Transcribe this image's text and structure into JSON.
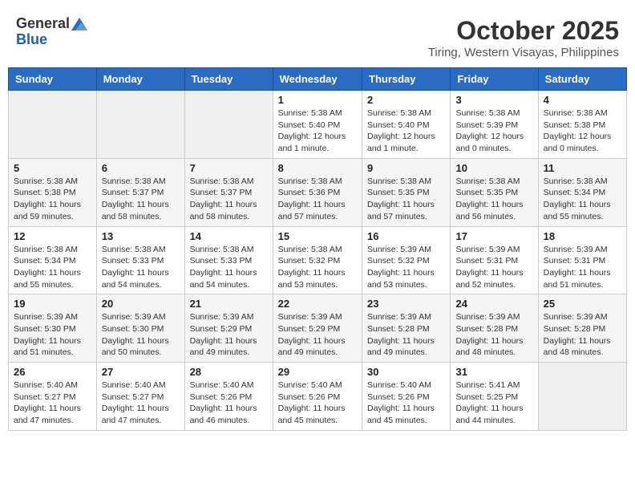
{
  "header": {
    "logo_general": "General",
    "logo_blue": "Blue",
    "month_title": "October 2025",
    "location": "Tiring, Western Visayas, Philippines"
  },
  "weekdays": [
    "Sunday",
    "Monday",
    "Tuesday",
    "Wednesday",
    "Thursday",
    "Friday",
    "Saturday"
  ],
  "weeks": [
    [
      {
        "day": "",
        "info": ""
      },
      {
        "day": "",
        "info": ""
      },
      {
        "day": "",
        "info": ""
      },
      {
        "day": "1",
        "info": "Sunrise: 5:38 AM\nSunset: 5:40 PM\nDaylight: 12 hours\nand 1 minute."
      },
      {
        "day": "2",
        "info": "Sunrise: 5:38 AM\nSunset: 5:40 PM\nDaylight: 12 hours\nand 1 minute."
      },
      {
        "day": "3",
        "info": "Sunrise: 5:38 AM\nSunset: 5:39 PM\nDaylight: 12 hours\nand 0 minutes."
      },
      {
        "day": "4",
        "info": "Sunrise: 5:38 AM\nSunset: 5:38 PM\nDaylight: 12 hours\nand 0 minutes."
      }
    ],
    [
      {
        "day": "5",
        "info": "Sunrise: 5:38 AM\nSunset: 5:38 PM\nDaylight: 11 hours\nand 59 minutes."
      },
      {
        "day": "6",
        "info": "Sunrise: 5:38 AM\nSunset: 5:37 PM\nDaylight: 11 hours\nand 58 minutes."
      },
      {
        "day": "7",
        "info": "Sunrise: 5:38 AM\nSunset: 5:37 PM\nDaylight: 11 hours\nand 58 minutes."
      },
      {
        "day": "8",
        "info": "Sunrise: 5:38 AM\nSunset: 5:36 PM\nDaylight: 11 hours\nand 57 minutes."
      },
      {
        "day": "9",
        "info": "Sunrise: 5:38 AM\nSunset: 5:35 PM\nDaylight: 11 hours\nand 57 minutes."
      },
      {
        "day": "10",
        "info": "Sunrise: 5:38 AM\nSunset: 5:35 PM\nDaylight: 11 hours\nand 56 minutes."
      },
      {
        "day": "11",
        "info": "Sunrise: 5:38 AM\nSunset: 5:34 PM\nDaylight: 11 hours\nand 55 minutes."
      }
    ],
    [
      {
        "day": "12",
        "info": "Sunrise: 5:38 AM\nSunset: 5:34 PM\nDaylight: 11 hours\nand 55 minutes."
      },
      {
        "day": "13",
        "info": "Sunrise: 5:38 AM\nSunset: 5:33 PM\nDaylight: 11 hours\nand 54 minutes."
      },
      {
        "day": "14",
        "info": "Sunrise: 5:38 AM\nSunset: 5:33 PM\nDaylight: 11 hours\nand 54 minutes."
      },
      {
        "day": "15",
        "info": "Sunrise: 5:38 AM\nSunset: 5:32 PM\nDaylight: 11 hours\nand 53 minutes."
      },
      {
        "day": "16",
        "info": "Sunrise: 5:39 AM\nSunset: 5:32 PM\nDaylight: 11 hours\nand 53 minutes."
      },
      {
        "day": "17",
        "info": "Sunrise: 5:39 AM\nSunset: 5:31 PM\nDaylight: 11 hours\nand 52 minutes."
      },
      {
        "day": "18",
        "info": "Sunrise: 5:39 AM\nSunset: 5:31 PM\nDaylight: 11 hours\nand 51 minutes."
      }
    ],
    [
      {
        "day": "19",
        "info": "Sunrise: 5:39 AM\nSunset: 5:30 PM\nDaylight: 11 hours\nand 51 minutes."
      },
      {
        "day": "20",
        "info": "Sunrise: 5:39 AM\nSunset: 5:30 PM\nDaylight: 11 hours\nand 50 minutes."
      },
      {
        "day": "21",
        "info": "Sunrise: 5:39 AM\nSunset: 5:29 PM\nDaylight: 11 hours\nand 49 minutes."
      },
      {
        "day": "22",
        "info": "Sunrise: 5:39 AM\nSunset: 5:29 PM\nDaylight: 11 hours\nand 49 minutes."
      },
      {
        "day": "23",
        "info": "Sunrise: 5:39 AM\nSunset: 5:28 PM\nDaylight: 11 hours\nand 49 minutes."
      },
      {
        "day": "24",
        "info": "Sunrise: 5:39 AM\nSunset: 5:28 PM\nDaylight: 11 hours\nand 48 minutes."
      },
      {
        "day": "25",
        "info": "Sunrise: 5:39 AM\nSunset: 5:28 PM\nDaylight: 11 hours\nand 48 minutes."
      }
    ],
    [
      {
        "day": "26",
        "info": "Sunrise: 5:40 AM\nSunset: 5:27 PM\nDaylight: 11 hours\nand 47 minutes."
      },
      {
        "day": "27",
        "info": "Sunrise: 5:40 AM\nSunset: 5:27 PM\nDaylight: 11 hours\nand 47 minutes."
      },
      {
        "day": "28",
        "info": "Sunrise: 5:40 AM\nSunset: 5:26 PM\nDaylight: 11 hours\nand 46 minutes."
      },
      {
        "day": "29",
        "info": "Sunrise: 5:40 AM\nSunset: 5:26 PM\nDaylight: 11 hours\nand 45 minutes."
      },
      {
        "day": "30",
        "info": "Sunrise: 5:40 AM\nSunset: 5:26 PM\nDaylight: 11 hours\nand 45 minutes."
      },
      {
        "day": "31",
        "info": "Sunrise: 5:41 AM\nSunset: 5:25 PM\nDaylight: 11 hours\nand 44 minutes."
      },
      {
        "day": "",
        "info": ""
      }
    ]
  ]
}
